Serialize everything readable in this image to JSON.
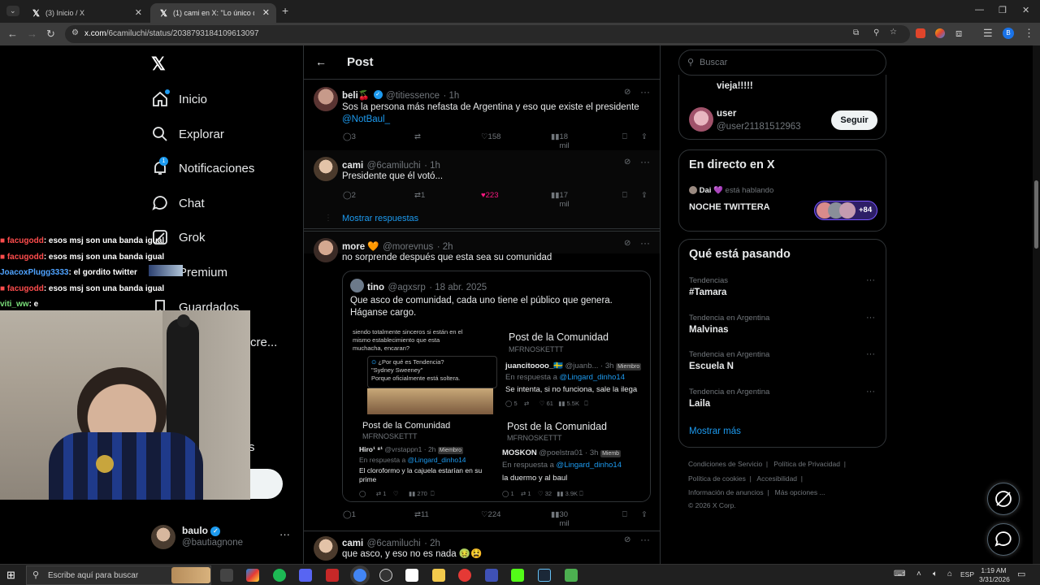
{
  "browser": {
    "tabs": [
      {
        "title": "(3) Inicio / X",
        "active": false
      },
      {
        "title": "(1) cami en X: \"Lo único que te",
        "active": true
      }
    ],
    "url_site": "x.com",
    "url_path": "/6camiluchi/status/2038793184109613097"
  },
  "sidebar": {
    "items": [
      {
        "label": "Inicio",
        "icon": "home-icon"
      },
      {
        "label": "Explorar",
        "icon": "search-icon"
      },
      {
        "label": "Notificaciones",
        "icon": "bell-icon",
        "badge": "1"
      },
      {
        "label": "Chat",
        "icon": "chat-icon"
      },
      {
        "label": "Grok",
        "icon": "grok-icon"
      },
      {
        "label": "Premium",
        "icon": "x-icon"
      },
      {
        "label": "Guardados",
        "icon": "bookmark-icon"
      }
    ],
    "partial_label": "cre...",
    "account": {
      "name": "baulo",
      "handle": "@bautiagnone"
    }
  },
  "header": {
    "title": "Post"
  },
  "tweets": [
    {
      "name": "beli🍒",
      "handle": "@titiessence",
      "time": "· 1h",
      "text": "Sos la persona más nefasta de Argentina y eso que existe el presidente",
      "mention": "@NotBaul_",
      "replies": "3",
      "retweets": "",
      "likes": "158",
      "views": "18 mil"
    },
    {
      "name": "cami",
      "handle": "@6camiluchi",
      "time": "· 1h",
      "text": "Presidente que él votó...",
      "replies": "2",
      "retweets": "1",
      "likes": "223",
      "views": "17 mil"
    },
    {
      "name": "more 🧡",
      "handle": "@morevnus",
      "time": "· 2h",
      "text": "no sorprende después que esta sea su comunidad",
      "replies": "1",
      "retweets": "11",
      "likes": "224",
      "views": "30 mil"
    },
    {
      "name": "cami",
      "handle": "@6camiluchi",
      "time": "· 2h",
      "text": "que asco, y eso no es nada 🤢😫"
    }
  ],
  "show_replies": "Mostrar respuestas",
  "quote": {
    "name": "tino",
    "handle": "@agxsrp",
    "time": "· 18 abr. 2025",
    "text1": "Que asco de comunidad, cada uno tiene el público que genera.",
    "text2": "Háganse cargo.",
    "img1_line1": "siendo totalmente sinceros si están en el",
    "img1_line2": "mismo establecimiento que esta",
    "img1_line3": "muchacha, encaran?",
    "img1_q": "¿Por qué es Tendencia?",
    "img1_q2": "\"Sydney Sweeney\"",
    "img1_q3": "Porque oficialmente está soltera.",
    "community_title": "Post de la Comunidad",
    "community_sub": "MFRNOSKETTT",
    "img2_name": "juancitoooo_🇸🇪",
    "img2_handle": "@juanb...",
    "img2_time": "· 3h",
    "badge": "Miembro",
    "reply_to": "En respuesta a",
    "reply_handle": "@Lingard_dinho14",
    "img2_text": "Se intenta, si no funciona, sale la ilega",
    "img2_stats": [
      "5",
      "61",
      "5.5K"
    ],
    "img3_name": "Hiro¹ ⁸¹",
    "img3_handle": "@vrstappn1",
    "img3_time": "· 2h",
    "img3_text1": "El cloroformo y la cajuela estarían en su",
    "img3_text2": "prime",
    "img3_stats": [
      "1",
      "270"
    ],
    "img4_name": "MOSKON",
    "img4_handle": "@poelstra01",
    "img4_time": "· 3h",
    "badge4": "Miemb",
    "img4_text": "la duermo y al baul",
    "img4_stats": [
      "1",
      "1",
      "32",
      "3.9K"
    ]
  },
  "right": {
    "search_placeholder": "Buscar",
    "top_partial": "vieja!!!!!",
    "suggest": {
      "name": "user",
      "handle": "@user21181512963",
      "button": "Seguir"
    },
    "live": {
      "title": "En directo en X",
      "host": "Dai 💜",
      "hosting": "está hablando",
      "space": "NOCHE TWITTERA",
      "count": "+84"
    },
    "trends_title": "Qué está pasando",
    "trends": [
      {
        "meta": "Tendencias",
        "name": "#Tamara"
      },
      {
        "meta": "Tendencia en Argentina",
        "name": "Malvinas"
      },
      {
        "meta": "Tendencia en Argentina",
        "name": "Escuela N"
      },
      {
        "meta": "Tendencia en Argentina",
        "name": "Laila"
      }
    ],
    "show_more": "Mostrar más",
    "footer": {
      "l1a": "Condiciones de Servicio",
      "l1b": "Política de Privacidad",
      "l2a": "Política de cookies",
      "l2b": "Accesibilidad",
      "l3a": "Información de anuncios",
      "l3b": "Más opciones ...",
      "copy": "© 2026 X Corp."
    }
  },
  "stream_chat": [
    {
      "user": "facugodd",
      "msg": ": esos msj son una banda igual",
      "color": "u"
    },
    {
      "user": "facugodd",
      "msg": ": esos msj son una banda igual",
      "color": "u"
    },
    {
      "user": "JoacoxPlugg3333",
      "msg": ": el gordito twitter",
      "color": "u2"
    },
    {
      "user": "facugodd",
      "msg": ": esos msj son una banda igual",
      "color": "u"
    },
    {
      "user": "viti_ww",
      "msg": ": e",
      "color": "u3"
    }
  ],
  "taskbar": {
    "search_placeholder": "Escribe aquí para buscar",
    "time": "1:19 AM",
    "date": "3/31/2026",
    "lang": "ESP"
  },
  "colors": {
    "accent": "#1d9bf0",
    "like": "#f91880",
    "border": "#2f3336",
    "muted": "#71767b"
  }
}
